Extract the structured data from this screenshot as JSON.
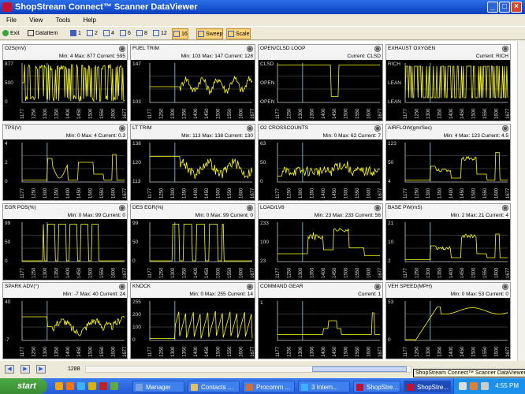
{
  "window": {
    "title": "ShopStream Connect™ Scanner DataViewer",
    "min": "_",
    "max": "□",
    "close": "×"
  },
  "menu": [
    "File",
    "View",
    "Tools",
    "Help"
  ],
  "toolbar": {
    "exit": "Exit",
    "dataitem": "DataItem",
    "layout_1": "1",
    "layout_2": "2",
    "layout_4": "4",
    "layout_6": "6",
    "layout_8": "8",
    "layout_12": "12",
    "layout_16": "16",
    "sweep": "Sweep",
    "scale": "Scale"
  },
  "x_ticks": [
    "1177",
    "1250",
    "1300",
    "1350",
    "1400",
    "1450",
    "1500",
    "1550",
    "1600",
    "1677"
  ],
  "panels": [
    {
      "title": "O2S(mV)",
      "stats": "Min: 4   Max: 877   Current: 595",
      "y": [
        "877",
        "500",
        "0"
      ],
      "trace": "o2"
    },
    {
      "title": "FUEL TRIM",
      "stats": "Min: 103   Max: 147   Current: 128",
      "y": [
        "147",
        "103"
      ],
      "trace": "ft"
    },
    {
      "title": "OPEN/CLSD LOOP",
      "stats": "Current: CLSD",
      "y": [
        "CLSD",
        "OPEN",
        "OPEN"
      ],
      "trace": "loop"
    },
    {
      "title": "EXHAUST OXYGEN",
      "stats": "Current: RICH",
      "y": [
        "RICH",
        "LEAN",
        "LEAN"
      ],
      "trace": "exo"
    },
    {
      "title": "TPS(V)",
      "stats": "Min: 0   Max: 4   Current: 0.3",
      "y": [
        "4",
        "2",
        "0"
      ],
      "trace": "tps"
    },
    {
      "title": "LT TRIM",
      "stats": "Min: 113   Max: 138   Current: 130",
      "y": [
        "138",
        "120",
        "113"
      ],
      "trace": "lt"
    },
    {
      "title": "O2 CROSSCOUNTS",
      "stats": "Min: 0   Max: 62   Current: 7",
      "y": [
        "63",
        "50",
        "0"
      ],
      "trace": "cc"
    },
    {
      "title": "AIRFLOW(gm/Sec)",
      "stats": "Min: 4   Max: 123   Current: 4.5",
      "y": [
        "123",
        "50",
        "4"
      ],
      "trace": "af"
    },
    {
      "title": "EGR POS(%)",
      "stats": "Min: 0   Max: 99   Current: 0",
      "y": [
        "99",
        "50",
        "0"
      ],
      "trace": "egr"
    },
    {
      "title": "DES EGR(%)",
      "stats": "Min: 0   Max: 99   Current: 0",
      "y": [
        "99",
        "50",
        "0"
      ],
      "trace": "egr2"
    },
    {
      "title": "LOAD/LV8",
      "stats": "Min: 23   Max: 233   Current: 56",
      "y": [
        "233",
        "100",
        "23"
      ],
      "trace": "load"
    },
    {
      "title": "BASE PW(mS)",
      "stats": "Min: 2   Max: 21   Current: 4",
      "y": [
        "21",
        "10",
        "2"
      ],
      "trace": "pw"
    },
    {
      "title": "SPARK ADV(°)",
      "stats": "Min: -7   Max: 40   Current: 24",
      "y": [
        "40",
        "-7"
      ],
      "trace": "spark"
    },
    {
      "title": "KNOCK",
      "stats": "Min: 0   Max: 255   Current: 14",
      "y": [
        "255",
        "200",
        "100",
        "0"
      ],
      "trace": "knock"
    },
    {
      "title": "COMMAND GEAR",
      "stats": "Current: 1",
      "y": [
        "1"
      ],
      "trace": "gear"
    },
    {
      "title": "VEH SPEED(MPH)",
      "stats": "Min: 0   Max: 53   Current: 0",
      "y": [
        "53",
        "0"
      ],
      "trace": "vs"
    }
  ],
  "position": "1288",
  "tooltip": "ShopStream Connect™ Scanner DataViewer",
  "taskbar": {
    "start": "start",
    "tasks": [
      "Manager",
      "Contacts ...",
      "Procomm ...",
      "3 Intern...",
      "ShopStre...",
      "ShopStre..."
    ],
    "clock": "4:55 PM"
  },
  "colors": {
    "trace": "#ffff00",
    "cursor": "#7fd7e8",
    "grid": "#666666",
    "title_bar": "#0a3fbf"
  }
}
